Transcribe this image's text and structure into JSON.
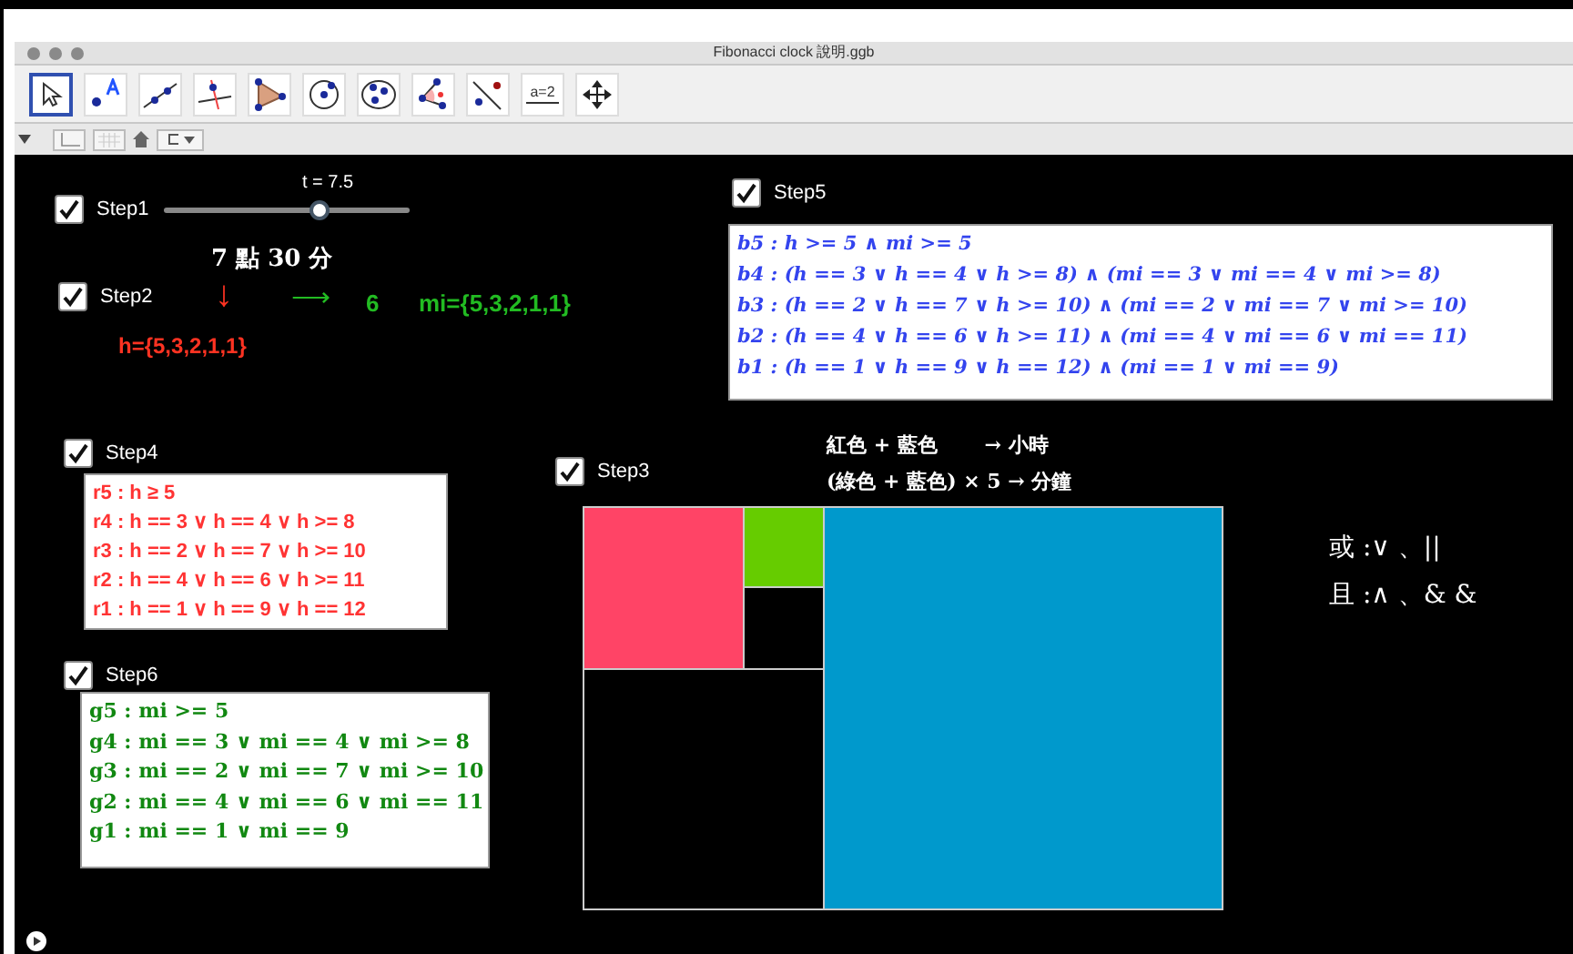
{
  "window": {
    "title": "Fibonacci clock 說明.ggb"
  },
  "toolbar": [
    {
      "kind": "move",
      "selected": true
    },
    {
      "kind": "point",
      "selected": false
    },
    {
      "kind": "line",
      "selected": false
    },
    {
      "kind": "perpendicular",
      "selected": false
    },
    {
      "kind": "polygon",
      "selected": false
    },
    {
      "kind": "circle",
      "selected": false
    },
    {
      "kind": "ellipse",
      "selected": false
    },
    {
      "kind": "angle",
      "selected": false
    },
    {
      "kind": "reflect",
      "selected": false
    },
    {
      "kind": "slider",
      "selected": false,
      "label": "a=2"
    },
    {
      "kind": "pan",
      "selected": false
    }
  ],
  "view_toggles": [
    {
      "kind": "axes",
      "selected": false
    },
    {
      "kind": "grid",
      "selected": false
    }
  ],
  "steps": [
    {
      "label": "Step1",
      "checked": true
    },
    {
      "label": "Step2",
      "checked": true
    },
    {
      "label": "Step5",
      "checked": true
    },
    {
      "label": "Step4",
      "checked": true
    },
    {
      "label": "Step6",
      "checked": true
    },
    {
      "label": "Step3",
      "checked": true
    }
  ],
  "slider": {
    "label": "t = 7.5",
    "level": 0.63
  },
  "time": {
    "text": "7 點 30 分",
    "hour_arrow": "↓",
    "hours": "h={5,3,2,1,1}",
    "minute_arrow": "⟶",
    "minute_value": "6",
    "minutes": "mi={5,3,2,1,1}"
  },
  "blue_rules": [
    "b5 : h >= 5 ∧ mi >= 5",
    "b4 : (h == 3 ∨ h == 4 ∨ h >= 8) ∧ (mi == 3 ∨ mi == 4 ∨ mi >= 8)",
    "b3 : (h == 2 ∨ h == 7 ∨ h >= 10) ∧ (mi == 2 ∨ mi == 7 ∨ mi >= 10)",
    "b2 : (h == 4 ∨ h == 6 ∨ h >= 11) ∧ (mi == 4 ∨ mi == 6 ∨ mi == 11)",
    "b1 : (h == 1 ∨ h == 9 ∨ h == 12) ∧ (mi == 1 ∨ mi == 9)"
  ],
  "red_rules": [
    "r5 : h ≥ 5",
    "r4 : h == 3 ∨ h == 4 ∨ h >= 8",
    "r3 : h == 2 ∨ h == 7 ∨ h >= 10",
    "r2 : h == 4 ∨ h == 6 ∨ h >= 11",
    "r1 : h == 1 ∨ h == 9 ∨ h == 12"
  ],
  "green_rules": [
    "g5 : mi >= 5",
    "g4 : mi == 3 ∨ mi == 4 ∨ mi >= 8",
    "g3 : mi == 2 ∨ mi == 7 ∨ mi >= 10",
    "g2 : mi == 4 ∨ mi == 6 ∨ mi == 11",
    "g1 : mi == 1 ∨ mi == 9"
  ],
  "legend": [
    "紅色 + 藍色 　　→ 小時",
    "(綠色 + 藍色) × 5 → 分鐘"
  ],
  "clock_tiles": [
    {
      "color": "#ff4466"
    },
    {
      "color": "#66cc00"
    },
    {
      "color": "#000000"
    },
    {
      "color": "#000000"
    },
    {
      "color": "#0099cc"
    }
  ],
  "operators": [
    "或 :∨ 、||",
    "且 :∧ 、& &"
  ]
}
